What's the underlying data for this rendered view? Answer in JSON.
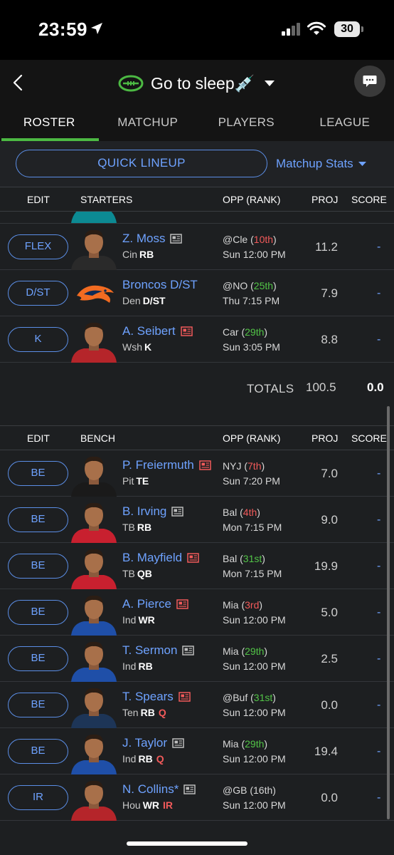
{
  "status_bar": {
    "time": "23:59",
    "battery": "30"
  },
  "header": {
    "team_name": "Go to sleep💉"
  },
  "tabs": [
    {
      "label": "ROSTER",
      "active": true
    },
    {
      "label": "MATCHUP",
      "active": false
    },
    {
      "label": "PLAYERS",
      "active": false
    },
    {
      "label": "LEAGUE",
      "active": false
    }
  ],
  "actions": {
    "quick_lineup": "QUICK LINEUP",
    "matchup_stats": "Matchup Stats"
  },
  "starters_header": {
    "edit": "EDIT",
    "group": "STARTERS",
    "opp": "OPP (RANK)",
    "proj": "PROJ",
    "score": "SCORE"
  },
  "starters": [
    {
      "slot": "FLEX",
      "name": "Z. Moss",
      "team": "Cin",
      "pos": "RB",
      "injury": "",
      "opp": "@Cle",
      "rank": "10th",
      "rank_color": "bad",
      "time": "Sun 12:00 PM",
      "proj": "11.2",
      "score": "-",
      "news_color": "gray",
      "jersey": "#2a2a2a"
    },
    {
      "slot": "D/ST",
      "name": "Broncos D/ST",
      "team": "Den",
      "pos": "D/ST",
      "injury": "",
      "opp": "@NO",
      "rank": "25th",
      "rank_color": "good",
      "time": "Thu 7:15 PM",
      "proj": "7.9",
      "score": "-",
      "news_color": "none",
      "jersey": "logo"
    },
    {
      "slot": "K",
      "name": "A. Seibert",
      "team": "Wsh",
      "pos": "K",
      "injury": "",
      "opp": "Car",
      "rank": "29th",
      "rank_color": "good",
      "time": "Sun 3:05 PM",
      "proj": "8.8",
      "score": "-",
      "news_color": "red",
      "jersey": "#b5252a"
    }
  ],
  "totals": {
    "label": "TOTALS",
    "proj": "100.5",
    "score": "0.0"
  },
  "bench_header": {
    "edit": "EDIT",
    "group": "BENCH",
    "opp": "OPP (RANK)",
    "proj": "PROJ",
    "score": "SCORE"
  },
  "bench": [
    {
      "slot": "BE",
      "name": "P. Freiermuth",
      "team": "Pit",
      "pos": "TE",
      "injury": "",
      "opp": "NYJ",
      "rank": "7th",
      "rank_color": "bad",
      "time": "Sun 7:20 PM",
      "proj": "7.0",
      "score": "-",
      "news_color": "red",
      "jersey": "#1a1a1a"
    },
    {
      "slot": "BE",
      "name": "B. Irving",
      "team": "TB",
      "pos": "RB",
      "injury": "",
      "opp": "Bal",
      "rank": "4th",
      "rank_color": "bad",
      "time": "Mon 7:15 PM",
      "proj": "9.0",
      "score": "-",
      "news_color": "gray",
      "jersey": "#c8202f"
    },
    {
      "slot": "BE",
      "name": "B. Mayfield",
      "team": "TB",
      "pos": "QB",
      "injury": "",
      "opp": "Bal",
      "rank": "31st",
      "rank_color": "good",
      "time": "Mon 7:15 PM",
      "proj": "19.9",
      "score": "-",
      "news_color": "red",
      "jersey": "#c8202f"
    },
    {
      "slot": "BE",
      "name": "A. Pierce",
      "team": "Ind",
      "pos": "WR",
      "injury": "",
      "opp": "Mia",
      "rank": "3rd",
      "rank_color": "bad",
      "time": "Sun 12:00 PM",
      "proj": "5.0",
      "score": "-",
      "news_color": "red",
      "jersey": "#1f4fa8"
    },
    {
      "slot": "BE",
      "name": "T. Sermon",
      "team": "Ind",
      "pos": "RB",
      "injury": "",
      "opp": "Mia",
      "rank": "29th",
      "rank_color": "good",
      "time": "Sun 12:00 PM",
      "proj": "2.5",
      "score": "-",
      "news_color": "gray",
      "jersey": "#1f4fa8"
    },
    {
      "slot": "BE",
      "name": "T. Spears",
      "team": "Ten",
      "pos": "RB",
      "injury": "Q",
      "opp": "@Buf",
      "rank": "31st",
      "rank_color": "good",
      "time": "Sun 12:00 PM",
      "proj": "0.0",
      "score": "-",
      "news_color": "red",
      "jersey": "#1d3557"
    },
    {
      "slot": "BE",
      "name": "J. Taylor",
      "team": "Ind",
      "pos": "RB",
      "injury": "Q",
      "opp": "Mia",
      "rank": "29th",
      "rank_color": "good",
      "time": "Sun 12:00 PM",
      "proj": "19.4",
      "score": "-",
      "news_color": "gray",
      "jersey": "#1f4fa8"
    },
    {
      "slot": "IR",
      "name": "N. Collins*",
      "team": "Hou",
      "pos": "WR",
      "injury": "IR",
      "opp": "@GB",
      "rank": "16th",
      "rank_color": "neutral",
      "time": "Sun 12:00 PM",
      "proj": "0.0",
      "score": "-",
      "news_color": "gray",
      "jersey": "#b5252a"
    }
  ],
  "colors": {
    "accent_blue": "#6ea2ff",
    "active_green": "#4cb943",
    "rank_bad": "#f25a5a",
    "rank_good": "#52c447",
    "background": "#1d1f21"
  }
}
